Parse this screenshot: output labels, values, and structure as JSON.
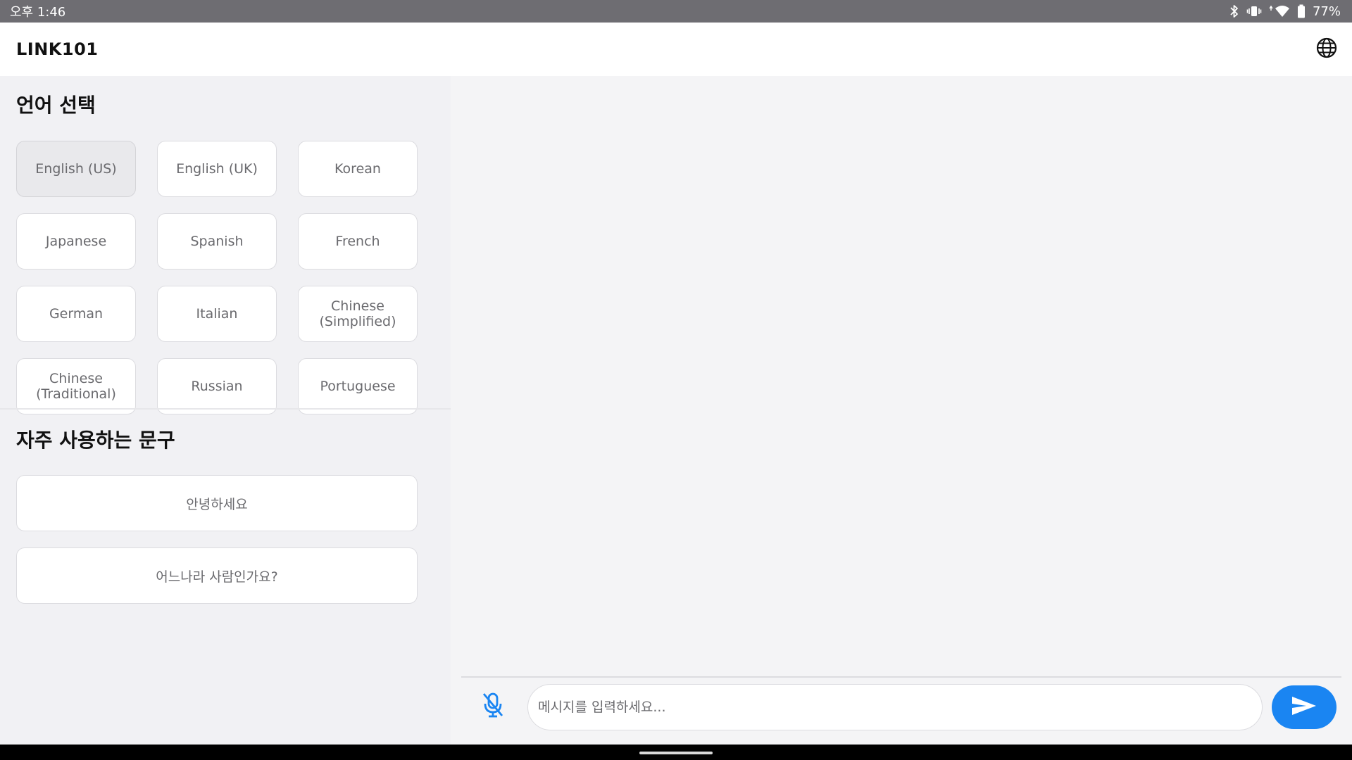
{
  "status_bar": {
    "time": "오후 1:46",
    "battery": "77%",
    "icons": [
      "bluetooth-icon",
      "vibrate-icon",
      "wifi-icon",
      "battery-icon"
    ]
  },
  "app_bar": {
    "title": "LINK101",
    "action_icon": "globe-icon"
  },
  "language_section": {
    "title": "언어 선택",
    "selected": "English (US)",
    "languages": [
      "English (US)",
      "English (UK)",
      "Korean",
      "Japanese",
      "Spanish",
      "French",
      "German",
      "Italian",
      "Chinese (Simplified)",
      "Chinese (Traditional)",
      "Russian",
      "Portuguese"
    ]
  },
  "phrases_section": {
    "title": "자주 사용하는 문구",
    "phrases": [
      "안녕하세요",
      "어느나라 사람인가요?"
    ]
  },
  "composer": {
    "placeholder": "메시지를 입력하세요...",
    "mic_icon": "mic-off-icon",
    "send_icon": "send-icon"
  },
  "colors": {
    "accent": "#1a85f2",
    "status_bar": "#6e6d72",
    "panel_bg": "#f1f1f4"
  }
}
